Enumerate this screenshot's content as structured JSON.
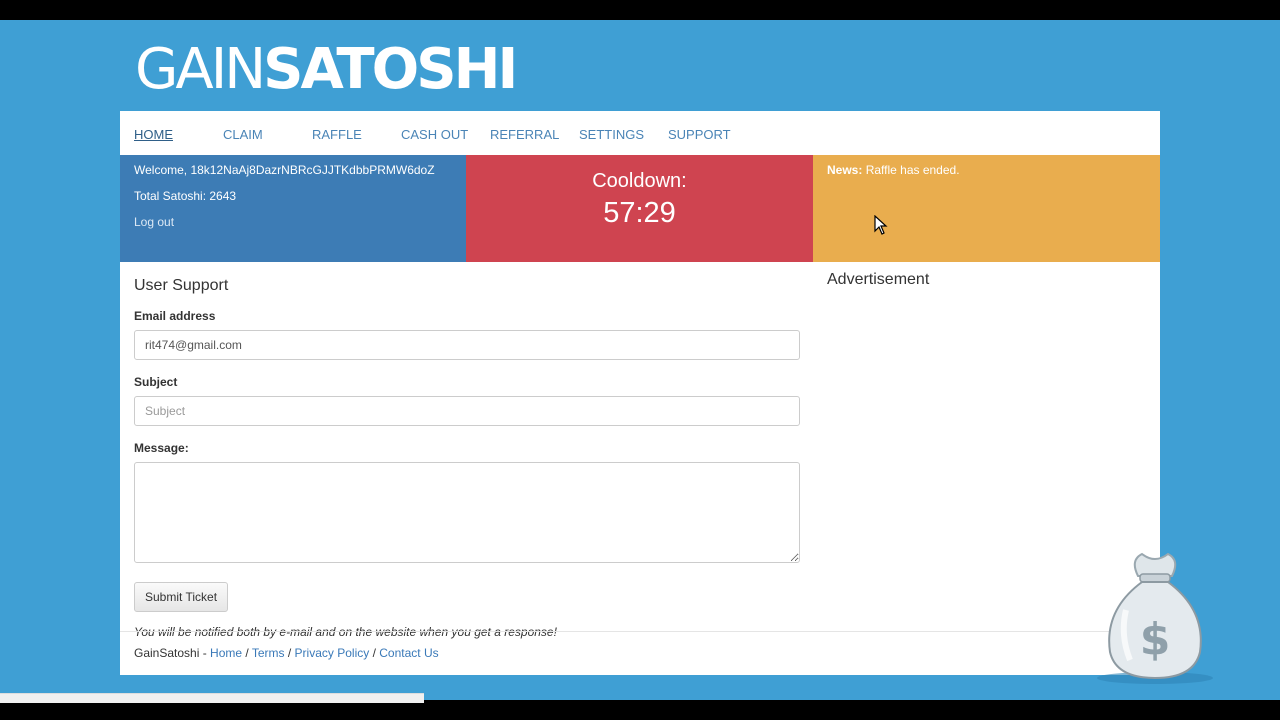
{
  "logo": {
    "thin": "GAIN",
    "bold": "SATOSHI"
  },
  "nav": {
    "items": [
      {
        "label": "HOME",
        "active": true
      },
      {
        "label": "CLAIM"
      },
      {
        "label": "RAFFLE"
      },
      {
        "label": "CASH OUT"
      },
      {
        "label": "REFERRAL"
      },
      {
        "label": "SETTINGS"
      },
      {
        "label": "SUPPORT"
      }
    ]
  },
  "account": {
    "welcome": "Welcome, 18k12NaAj8DazrNBRcGJJTKdbbPRMW6doZ",
    "total": "Total Satoshi: 2643",
    "logout": "Log out"
  },
  "cooldown": {
    "label": "Cooldown:",
    "time": "57:29"
  },
  "news": {
    "label": "News:",
    "text": "Raffle has ended."
  },
  "support": {
    "title": "User Support",
    "email_label": "Email address",
    "email_value": "rit474@gmail.com",
    "subject_label": "Subject",
    "subject_placeholder": "Subject",
    "message_label": "Message:",
    "submit_label": "Submit Ticket",
    "notice": "You will be notified both by e-mail and on the website when you get a response!"
  },
  "advertisement": {
    "title": "Advertisement"
  },
  "footer": {
    "brand": "GainSatoshi - ",
    "links": [
      "Home",
      "Terms",
      "Privacy Policy",
      "Contact Us"
    ],
    "separator": " / "
  },
  "colors": {
    "background": "#3f9fd4",
    "account_box": "#3d7cb5",
    "cooldown_box": "#cf4450",
    "news_box": "#e9ad4e",
    "link": "#3a79b8"
  },
  "icons": {
    "bag": "money-bag-icon",
    "cursor": "mouse-cursor-icon"
  }
}
